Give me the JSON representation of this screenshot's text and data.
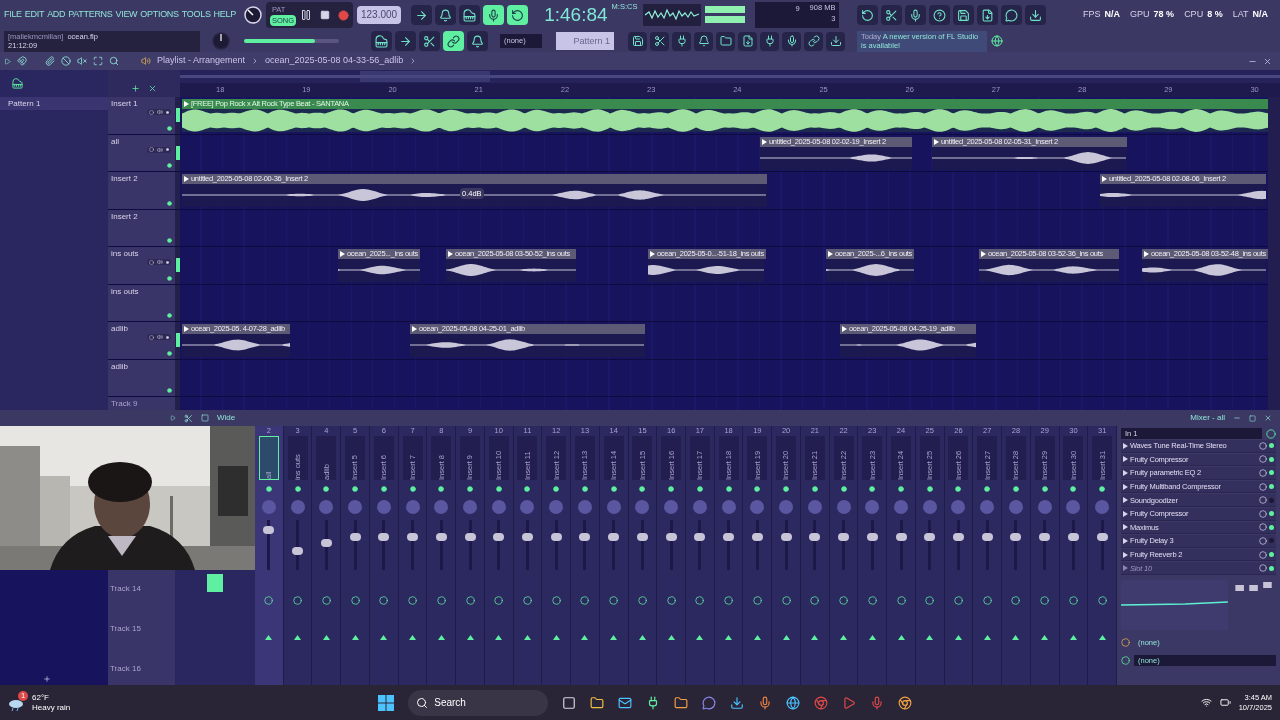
{
  "menu": [
    "FILE",
    "EDIT",
    "ADD",
    "PATTERNS",
    "VIEW",
    "OPTIONS",
    "TOOLS",
    "HELP"
  ],
  "transport": {
    "modes": [
      {
        "label": "PAT",
        "selected": false
      },
      {
        "label": "SONG",
        "selected": true
      }
    ],
    "tempo": "123.000"
  },
  "time": {
    "value": "1:46:84",
    "unit": "M:S:CS"
  },
  "cpu_panel": {
    "voices": "9",
    "memory": "908 MB",
    "polyphony": "3"
  },
  "toggles_row1": [
    {
      "on": false
    },
    {
      "on": false
    },
    {
      "on": false
    },
    {
      "on": true
    },
    {
      "on": true
    }
  ],
  "toggles_row2": [
    {
      "on": false
    },
    {
      "on": false
    },
    {
      "on": false
    },
    {
      "on": true
    },
    {
      "on": false
    }
  ],
  "stats": [
    {
      "label": "FPS",
      "value": "N/A"
    },
    {
      "label": "GPU",
      "value": "78 %"
    },
    {
      "label": "CPU",
      "value": "8 %"
    },
    {
      "label": "LAT",
      "value": "N/A"
    }
  ],
  "project": {
    "user": "[maliekmcmillan]",
    "file": "ocean.flp",
    "time": "21:12:09"
  },
  "master_volume": {
    "level": 0.75
  },
  "channel_select": "(none)",
  "pattern": "Pattern 1",
  "news": {
    "when": "Today",
    "text": "A newer version of FL Studio is available!"
  },
  "playlist": {
    "title": "Playlist - Arrangement",
    "path": "ocean_2025-05-08 04-33-56_adlib",
    "picker": [
      {
        "label": "Pattern 1",
        "selected": true
      }
    ],
    "ruler": [
      "18",
      "19",
      "20",
      "21",
      "22",
      "23",
      "24",
      "25",
      "26",
      "27",
      "28",
      "29",
      "30"
    ],
    "tooltip": "0.4dB",
    "tracks": [
      {
        "name": "Insert 1",
        "controls": true,
        "clips": [
          {
            "label": "[FREE] Pop Rock x Alt Rock Type Beat - SANTANA",
            "kind": "beat"
          }
        ]
      },
      {
        "name": "all",
        "controls": true,
        "clips": [
          {
            "label": "untitled_2025-05-08 02-02-19_Insert 2",
            "kind": "audio"
          },
          {
            "label": "untitled_2025-05-08 02-05-31_Insert 2",
            "kind": "audio"
          }
        ]
      },
      {
        "name": "Insert 2",
        "controls": false,
        "clips": [
          {
            "label": "untitled_2025-05-08 02-00-36_Insert 2",
            "kind": "audio"
          },
          {
            "label": "untitled_2025-05-08 02-08-06_Insert 2",
            "kind": "audio"
          }
        ]
      },
      {
        "name": "Insert 2",
        "controls": false
      },
      {
        "name": "ins outs",
        "controls": true,
        "clips": [
          {
            "label": "ocean_2025..._ins outs",
            "kind": "audio"
          },
          {
            "label": "ocean_2025-05-08 03-50-52_ins outs",
            "kind": "audio"
          },
          {
            "label": "ocean_2025-05-0...-51-18_ins outs",
            "kind": "audio"
          },
          {
            "label": "ocean_2025-...6_ins outs",
            "kind": "audio"
          },
          {
            "label": "ocean_2025-05-08 03-52-36_ins outs",
            "kind": "audio"
          },
          {
            "label": "ocean_2025-05-08 03-52-48_ins outs",
            "kind": "audio"
          }
        ]
      },
      {
        "name": "ins outs",
        "controls": false
      },
      {
        "name": "adlib",
        "controls": true,
        "clips": [
          {
            "label": "ocean_2025-05. 4-07-28_adlib",
            "kind": "audio"
          },
          {
            "label": "ocean_2025-05-08 04-25-01_adlib",
            "kind": "audio"
          },
          {
            "label": "ocean_2025-05-08 04-25-19_adlib",
            "kind": "audio"
          }
        ]
      },
      {
        "name": "adlib",
        "controls": false
      },
      {
        "name": "Track 9",
        "controls": false
      }
    ]
  },
  "mixer": {
    "title": "Mixer - all",
    "view": "Wide",
    "lanes": [
      "Track 14",
      "Track 15",
      "Track 16"
    ],
    "strips": [
      {
        "number": "2",
        "name": "all",
        "selected": true,
        "level": 0.85
      },
      {
        "number": "3",
        "name": "ins outs",
        "selected": false,
        "level": 0.35
      },
      {
        "number": "4",
        "name": "adlib",
        "selected": false,
        "level": 0.55
      },
      {
        "number": "5",
        "name": "Insert 5",
        "selected": false,
        "level": 0.7
      },
      {
        "number": "6",
        "name": "Insert 6",
        "selected": false,
        "level": 0.7
      },
      {
        "number": "7",
        "name": "Insert 7",
        "selected": false,
        "level": 0.7
      },
      {
        "number": "8",
        "name": "Insert 8",
        "selected": false,
        "level": 0.7
      },
      {
        "number": "9",
        "name": "Insert 9",
        "selected": false,
        "level": 0.7
      },
      {
        "number": "10",
        "name": "Insert 10",
        "selected": false,
        "level": 0.7
      },
      {
        "number": "11",
        "name": "Insert 11",
        "selected": false,
        "level": 0.7
      },
      {
        "number": "12",
        "name": "Insert 12",
        "selected": false,
        "level": 0.7
      },
      {
        "number": "13",
        "name": "Insert 13",
        "selected": false,
        "level": 0.7
      },
      {
        "number": "14",
        "name": "Insert 14",
        "selected": false,
        "level": 0.7
      },
      {
        "number": "15",
        "name": "Insert 15",
        "selected": false,
        "level": 0.7
      },
      {
        "number": "16",
        "name": "Insert 16",
        "selected": false,
        "level": 0.7
      },
      {
        "number": "17",
        "name": "Insert 17",
        "selected": false,
        "level": 0.7
      },
      {
        "number": "18",
        "name": "Insert 18",
        "selected": false,
        "level": 0.7
      },
      {
        "number": "19",
        "name": "Insert 19",
        "selected": false,
        "level": 0.7
      },
      {
        "number": "20",
        "name": "Insert 20",
        "selected": false,
        "level": 0.7
      },
      {
        "number": "21",
        "name": "Insert 21",
        "selected": false,
        "level": 0.7
      },
      {
        "number": "22",
        "name": "Insert 22",
        "selected": false,
        "level": 0.7
      },
      {
        "number": "23",
        "name": "Insert 23",
        "selected": false,
        "level": 0.7
      },
      {
        "number": "24",
        "name": "Insert 24",
        "selected": false,
        "level": 0.7
      },
      {
        "number": "25",
        "name": "Insert 25",
        "selected": false,
        "level": 0.7
      },
      {
        "number": "26",
        "name": "Insert 26",
        "selected": false,
        "level": 0.7
      },
      {
        "number": "27",
        "name": "Insert 27",
        "selected": false,
        "level": 0.7
      },
      {
        "number": "28",
        "name": "Insert 28",
        "selected": false,
        "level": 0.7
      },
      {
        "number": "29",
        "name": "Insert 29",
        "selected": false,
        "level": 0.7
      },
      {
        "number": "30",
        "name": "Insert 30",
        "selected": false,
        "level": 0.7
      },
      {
        "number": "31",
        "name": "Insert 31",
        "selected": false,
        "level": 0.7
      }
    ],
    "input": "In 1",
    "slots": [
      {
        "name": "Waves Tune Real-Time Stereo",
        "on": true,
        "empty": false
      },
      {
        "name": "Fruity Compressor",
        "on": true,
        "empty": false
      },
      {
        "name": "Fruity parametric EQ 2",
        "on": true,
        "empty": false
      },
      {
        "name": "Fruity Multiband Compressor",
        "on": true,
        "empty": false
      },
      {
        "name": "Soundgoodizer",
        "on": false,
        "empty": false
      },
      {
        "name": "Fruity Compressor",
        "on": true,
        "empty": false
      },
      {
        "name": "Maximus",
        "on": true,
        "empty": false
      },
      {
        "name": "Fruity Delay 3",
        "on": false,
        "empty": false
      },
      {
        "name": "Fruity Reeverb 2",
        "on": true,
        "empty": false
      },
      {
        "name": "Slot 10",
        "on": true,
        "empty": true
      }
    ],
    "routes": [
      "(none)",
      "(none)"
    ]
  },
  "taskbar": {
    "weather": {
      "badge": "1",
      "temp": "62°F",
      "text": "Heavy rain"
    },
    "search": {
      "placeholder": "Search"
    },
    "time": "3:45 AM",
    "date": "10/7/2025"
  }
}
